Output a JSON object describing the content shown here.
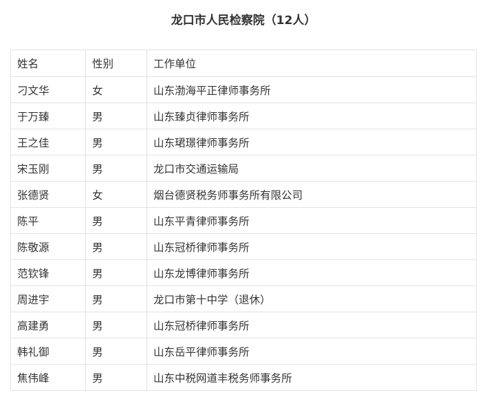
{
  "title": "龙口市人民检察院（12人）",
  "table": {
    "headers": [
      "姓名",
      "性别",
      "工作单位"
    ],
    "rows": [
      [
        "刁文华",
        "女",
        "山东渤海平正律师事务所"
      ],
      [
        "于万臻",
        "男",
        "山东臻贞律师事务所"
      ],
      [
        "王之佳",
        "男",
        "山东珺璟律师事务所"
      ],
      [
        "宋玉刚",
        "男",
        "龙口市交通运输局"
      ],
      [
        "张德贤",
        "女",
        "烟台德贤税务师事务所有限公司"
      ],
      [
        "陈平",
        "男",
        "山东平青律师事务所"
      ],
      [
        "陈敬源",
        "男",
        "山东冠桥律师事务所"
      ],
      [
        "范钦锋",
        "男",
        "山东龙博律师事务所"
      ],
      [
        "周进宇",
        "男",
        "龙口市第十中学（退休）"
      ],
      [
        "高建勇",
        "男",
        "山东冠桥律师事务所"
      ],
      [
        "韩礼御",
        "男",
        "山东岳平律师事务所"
      ],
      [
        "焦伟峰",
        "男",
        "山东中税网道丰税务师事务所"
      ]
    ]
  }
}
